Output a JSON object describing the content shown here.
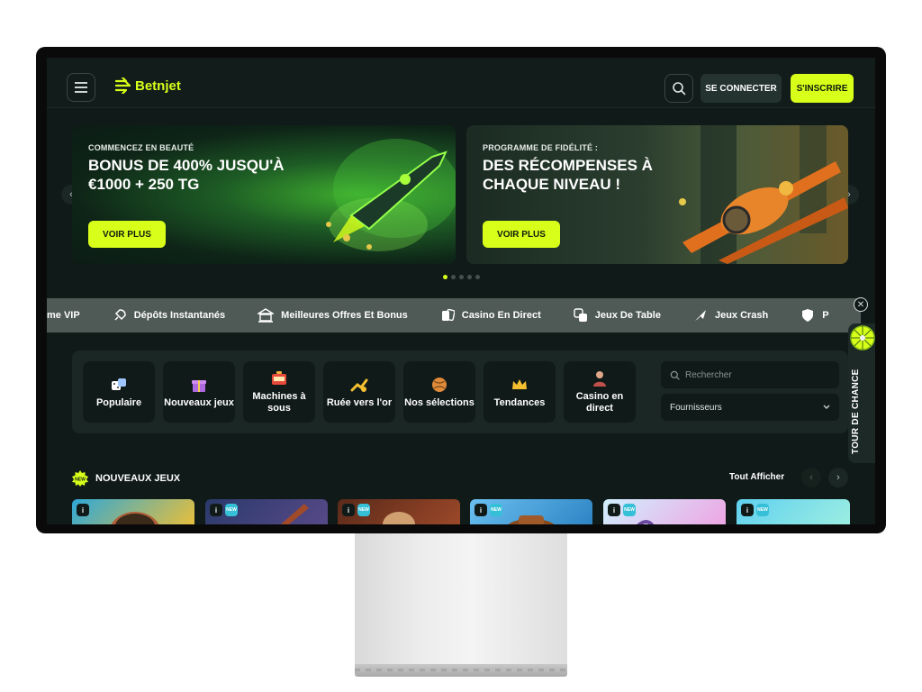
{
  "header": {
    "logo_text": "Betnjet",
    "login_label": "SE CONNECTER",
    "signup_label": "S'INSCRIRE"
  },
  "banners": [
    {
      "kicker": "COMMENCEZ EN BEAUTÉ",
      "headline": "BONUS DE 400% JUSQU'À €1000 + 250 TG",
      "cta": "VOIR PLUS"
    },
    {
      "kicker": "PROGRAMME DE FIDÉLITÉ :",
      "headline": "DES RÉCOMPENSES À CHAQUE NIVEAU !",
      "cta": "VOIR PLUS"
    }
  ],
  "ticker": {
    "items": [
      {
        "label": "me VIP",
        "icon": "crown-icon"
      },
      {
        "label": "Dépôts Instantanés",
        "icon": "rocket-icon"
      },
      {
        "label": "Meilleures Offres Et Bonus",
        "icon": "casino-building-icon"
      },
      {
        "label": "Casino En Direct",
        "icon": "cards-icon"
      },
      {
        "label": "Jeux De Table",
        "icon": "dice-icon"
      },
      {
        "label": "Jeux Crash",
        "icon": "plane-icon"
      },
      {
        "label": "P",
        "icon": "shield-icon"
      }
    ]
  },
  "categories": [
    {
      "label": "Populaire",
      "icon": "dice-icon"
    },
    {
      "label": "Nouveaux jeux",
      "icon": "gift-icon"
    },
    {
      "label": "Machines à sous",
      "icon": "slot-machine-icon"
    },
    {
      "label": "Ruée vers l'or",
      "icon": "gold-icon"
    },
    {
      "label": "Nos sélections",
      "icon": "ball-icon"
    },
    {
      "label": "Tendances",
      "icon": "crown-icon"
    },
    {
      "label": "Casino en direct",
      "icon": "dealer-icon"
    }
  ],
  "search": {
    "placeholder": "Rechercher"
  },
  "providers": {
    "label": "Fournisseurs"
  },
  "wheel": {
    "label": "TOUR DE CHANCE"
  },
  "new_games": {
    "title": "NOUVEAUX JEUX",
    "view_all": "Tout Afficher",
    "badge_info": "i",
    "badge_new": "NEW"
  },
  "colors": {
    "accent": "#d8ff1a",
    "background": "#101a18",
    "panel": "#1a2724",
    "ticker": "#4f5a57"
  }
}
